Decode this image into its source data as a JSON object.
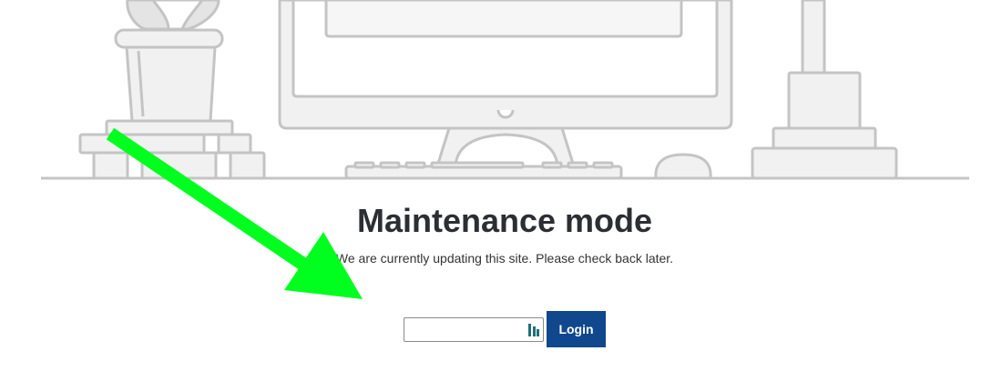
{
  "page": {
    "title": "Maintenance mode",
    "message": "We are currently updating this site. Please check back later."
  },
  "login": {
    "password_value": "",
    "password_placeholder": "",
    "button_label": "Login"
  },
  "icons": {
    "password_manager": "password-manager-icon"
  },
  "colors": {
    "button_bg": "#10478d",
    "button_text": "#ffffff",
    "title_text": "#2b2e33",
    "illustration_stroke": "#c4c4c4",
    "illustration_fill": "#f1f1f1",
    "annotation_arrow": "#00ff1e"
  }
}
